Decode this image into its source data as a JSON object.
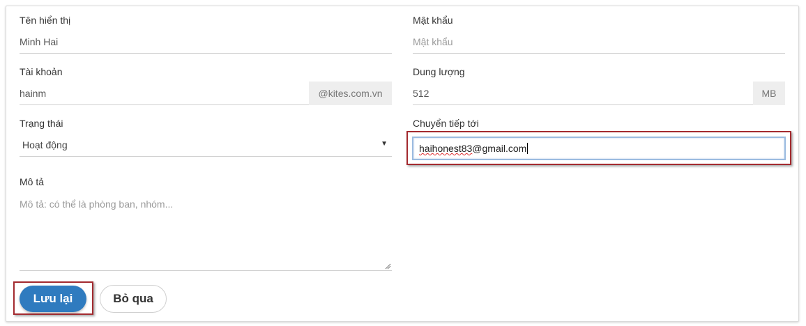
{
  "form": {
    "display_name": {
      "label": "Tên hiển thị",
      "value": "Minh Hai"
    },
    "password": {
      "label": "Mật khẩu",
      "placeholder": "Mật khẩu"
    },
    "account": {
      "label": "Tài khoản",
      "value": "hainm",
      "domain": "@kites.com.vn"
    },
    "quota": {
      "label": "Dung lượng",
      "value": "512",
      "unit": "MB"
    },
    "status": {
      "label": "Trạng thái",
      "selected": "Hoạt động"
    },
    "forward_to": {
      "label": "Chuyển tiếp tới",
      "user": "haihonest83",
      "rest": "@gmail.com"
    },
    "description": {
      "label": "Mô tả",
      "placeholder": "Mô tả: có thể là phòng ban, nhóm..."
    }
  },
  "actions": {
    "save_label": "Lưu lại",
    "cancel_label": "Bỏ qua"
  },
  "colors": {
    "primary": "#2f7bbf",
    "highlight": "#a32a2f",
    "focus_border": "#9bbbe0"
  }
}
